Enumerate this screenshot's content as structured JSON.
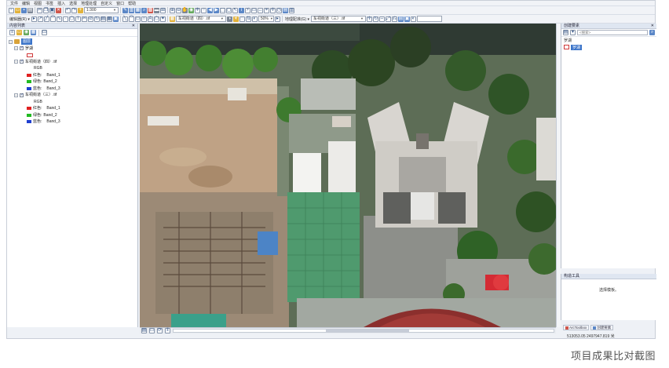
{
  "menu": [
    "文件",
    "编辑",
    "视图",
    "书签",
    "插入",
    "选择",
    "地理处理",
    "自定义",
    "窗口",
    "帮助"
  ],
  "toolbar": {
    "scale": "1:300",
    "editor_label": "编辑器(R) ▾",
    "layer_combo": "车祠街道（四）.tif",
    "zoom_combo": "50%",
    "georef_label": "地理配准(G) ▾",
    "georef_combo": "车祠街道（三）.tif"
  },
  "toc": {
    "title": "内容列表",
    "pin": "✕",
    "root": "图层",
    "layers": [
      {
        "name": "罗湖",
        "kind": "polygon"
      },
      {
        "name": "车祠街道（四）.tif",
        "kind": "raster",
        "mode": "RGB",
        "bands": [
          {
            "label": "红色:",
            "band": "Band_1",
            "color": "#e02020"
          },
          {
            "label": "绿色:",
            "band": "Band_2",
            "color": "#22bb22"
          },
          {
            "label": "蓝色:",
            "band": "Band_3",
            "color": "#1f3fd0"
          }
        ]
      },
      {
        "name": "车祠街道（三）.tif",
        "kind": "raster",
        "mode": "RGB",
        "bands": [
          {
            "label": "红色:",
            "band": "Band_1",
            "color": "#e02020"
          },
          {
            "label": "绿色:",
            "band": "Band_2",
            "color": "#22bb22"
          },
          {
            "label": "蓝色:",
            "band": "Band_3",
            "color": "#1f3fd0"
          }
        ]
      }
    ]
  },
  "create_features": {
    "title": "创建要素",
    "search_placeholder": "<搜索>",
    "group": "罗湖",
    "item": "罗湖"
  },
  "construct_tools": {
    "title": "构造工具",
    "message": "选择模板。"
  },
  "tabs": [
    "ArcToolbox",
    "创建要素"
  ],
  "status": {
    "coords": "513053.05  2497947.819 米"
  },
  "caption": "项目成果比对截图"
}
